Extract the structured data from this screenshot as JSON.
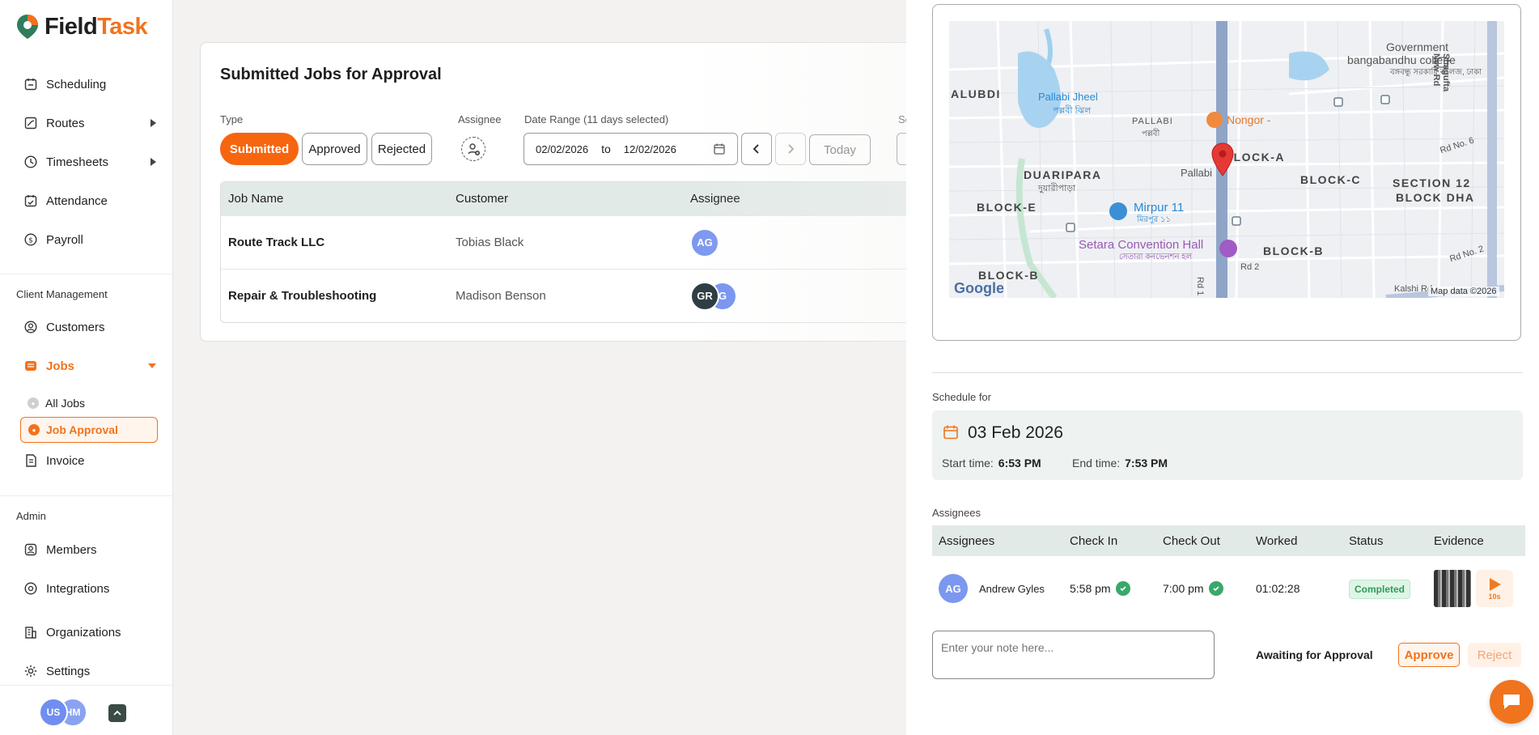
{
  "brand": {
    "name_part1": "Field",
    "name_part2": "Task"
  },
  "sidebar": {
    "items": [
      {
        "label": "Scheduling"
      },
      {
        "label": "Routes"
      },
      {
        "label": "Timesheets"
      },
      {
        "label": "Attendance"
      },
      {
        "label": "Payroll"
      }
    ],
    "client_section": "Client Management",
    "client_items": [
      {
        "label": "Customers"
      },
      {
        "label": "Jobs"
      }
    ],
    "jobs_sub": [
      {
        "label": "All Jobs"
      },
      {
        "label": "Job Approval"
      }
    ],
    "invoice": "Invoice",
    "admin_section": "Admin",
    "admin_items": [
      {
        "label": "Members"
      },
      {
        "label": "Integrations"
      },
      {
        "label": "Organizations"
      },
      {
        "label": "Settings"
      }
    ],
    "user_initials": [
      "US",
      "HM"
    ]
  },
  "main": {
    "title": "Submitted Jobs for Approval",
    "type_label": "Type",
    "types": [
      "Submitted",
      "Approved",
      "Rejected"
    ],
    "assignee_label": "Assignee",
    "date_range_label": "Date Range (11 days selected)",
    "date_from": "02/02/2026",
    "date_to_word": "to",
    "date_to": "12/02/2026",
    "today": "Today",
    "se_label": "Se",
    "columns": [
      "Job Name",
      "Customer",
      "Assignee"
    ],
    "rows": [
      {
        "job": "Route Track LLC",
        "customer": "Tobias Black",
        "assignees": [
          "AG"
        ]
      },
      {
        "job": "Repair & Troubleshooting",
        "customer": "Madison Benson",
        "assignees": [
          "GR",
          "G"
        ]
      }
    ]
  },
  "map": {
    "labels": {
      "alubdi": "ALUBDI",
      "pallabi_jheel": "Pallabi Jheel",
      "pallabi_jheel_bn": "পল্লবী ঝিল",
      "pallabi": "PALLABI",
      "pallabi_bn": "পল্লবী",
      "nongor": "Nongor -",
      "government": "Government",
      "bangabandhu": "bangabandhu college",
      "college_bn": "বঙ্গবন্ধু সরকারি কলেজ, ঢাকা",
      "shagufta": "Shagufta New Rd",
      "duaripara": "DUARIPARA",
      "duaripara_bn": "দুয়ারীপাড়া",
      "block_a": "BLOCK-A",
      "pallabi_stn": "Pallabi",
      "block_c": "BLOCK-C",
      "section12": "SECTION 12",
      "block_dha": "BLOCK DHA",
      "rd_no_6": "Rd No. 6",
      "block_e": "BLOCK-E",
      "mirpur11": "Mirpur 11",
      "mirpur11_bn": "মিরপুর ১১",
      "setara": "Setara Convention Hall",
      "setara_bn": "সেতারা কনভেনশন হল",
      "block_b": "BLOCK-B",
      "block_b2": "BLOCK-B",
      "rd_no_2": "Rd No. 2",
      "rd2": "Rd 2",
      "rd1": "Rd 1",
      "kalshi": "Kalshi Rd",
      "google": "Google",
      "map_data": "Map data ©2026"
    }
  },
  "schedule": {
    "label": "Schedule for",
    "date": "03 Feb 2026",
    "start_label": "Start time:",
    "start": "6:53 PM",
    "end_label": "End time:",
    "end": "7:53 PM"
  },
  "assignees": {
    "label": "Assignees",
    "columns": [
      "Assignees",
      "Check In",
      "Check Out",
      "Worked",
      "Status",
      "Evidence"
    ],
    "row": {
      "initials": "AG",
      "name": "Andrew Gyles",
      "check_in": "5:58 pm",
      "check_out": "7:00 pm",
      "worked": "01:02:28",
      "status": "Completed",
      "video_len": "10s"
    }
  },
  "approval": {
    "note_placeholder": "Enter your note here...",
    "awaiting": "Awaiting for Approval",
    "approve": "Approve",
    "reject": "Reject"
  },
  "colors": {
    "accent": "#f0731e",
    "header_bg": "#e2eae8",
    "success": "#3aa86b"
  }
}
